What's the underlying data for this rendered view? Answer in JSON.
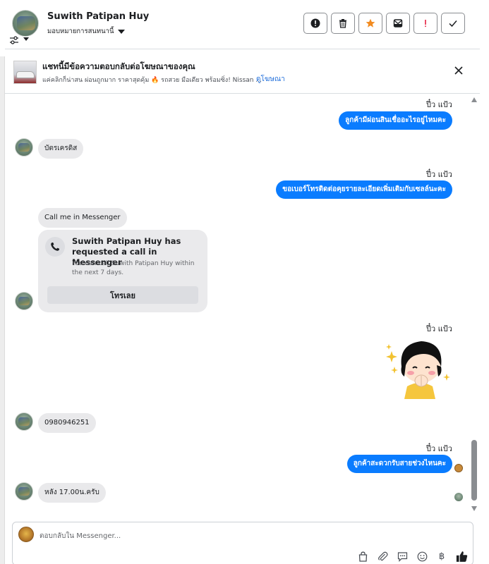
{
  "header": {
    "contact_name": "Suwith Patipan Huy",
    "assign_label": "มอบหมายการสนทนานี้",
    "icons": [
      "alert-circle-icon",
      "trash-icon",
      "star-icon",
      "mark-unread-icon",
      "exclamation-icon",
      "check-icon"
    ],
    "star_color": "#f28b20",
    "exclamation_color": "#e41e3f"
  },
  "ad_banner": {
    "title": "แชทนี้มีข้อความตอบกลับต่อโฆษณาของคุณ",
    "description": "แค่คลิกก็น่าสน ผ่อนถูกมาก ราคาสุดคุ้ม 🔥 รถสวย มือเดียว พร้อมซิ่ง! Nissan ...",
    "link_label": "ดูโฆษณา"
  },
  "messages": {
    "m1_time": "ปี๋ว แป้ว",
    "m1_text": "ลูกค้ามีผ่อนสินเชื่ออะไรอยู่ไหมคะ",
    "m2_text": "บัตรเครดิส",
    "m3_time": "ปี๋ว แป้ว",
    "m3_text": "ขอเบอร์โทรติดต่อคุยรายละเอียดเพิ่มเติมกับเซลล์นะคะ",
    "m4_text": "Call me in Messenger",
    "call_card": {
      "title": "Suwith Patipan Huy has requested a call in Messenger",
      "subtitle": "You can call Suwith Patipan Huy within the next 7 days.",
      "button_label": "โทรเลย"
    },
    "m5_time": "ปี๋ว แป้ว",
    "m6_text": "0980946251",
    "m7_time": "ปี๋ว แป้ว",
    "m7_text": "ลูกค้าสะดวกรับสายช่วงไหนคะ",
    "m8_text": "หลัง 17.00น.ครับ"
  },
  "composer": {
    "placeholder": "ตอบกลับใน Messenger...",
    "tools": [
      "bag-icon",
      "paperclip-icon",
      "chat-reply-icon",
      "emoji-icon",
      "baht-icon",
      "thumbs-up-icon"
    ],
    "baht_symbol": "฿"
  },
  "colors": {
    "outgoing_bubble": "#0a7cff",
    "incoming_bubble": "#e9e9eb",
    "link": "#216fdb"
  }
}
